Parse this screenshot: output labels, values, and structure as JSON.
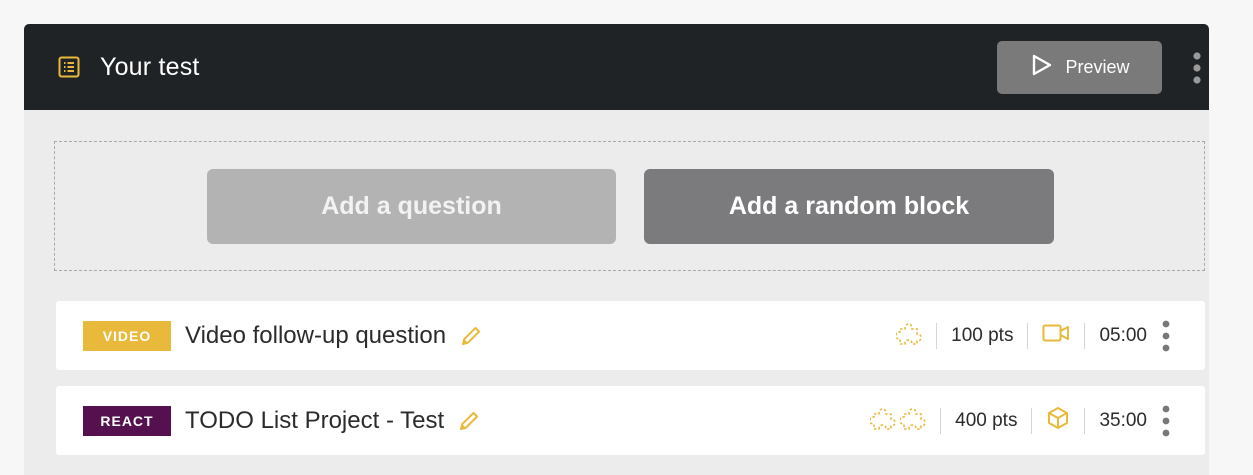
{
  "header": {
    "title": "Your test",
    "preview_label": "Preview"
  },
  "actions": {
    "add_question_label": "Add a question",
    "add_random_block_label": "Add a random block"
  },
  "questions": [
    {
      "tag": "VIDEO",
      "tag_color": "#e8b93a",
      "title": "Video follow-up question",
      "difficulty_icons": [
        "puzzle-icon"
      ],
      "points": "100 pts",
      "type_icon": "video-camera-icon",
      "time": "05:00"
    },
    {
      "tag": "REACT",
      "tag_color": "#55104f",
      "title": "TODO List Project - Test",
      "difficulty_icons": [
        "puzzle-icon",
        "puzzle-icon"
      ],
      "points": "400 pts",
      "type_icon": "cube-icon",
      "time": "35:00"
    }
  ],
  "colors": {
    "header_bg": "#1f2326",
    "accent": "#e8b93a",
    "panel_bg": "#ececec"
  }
}
